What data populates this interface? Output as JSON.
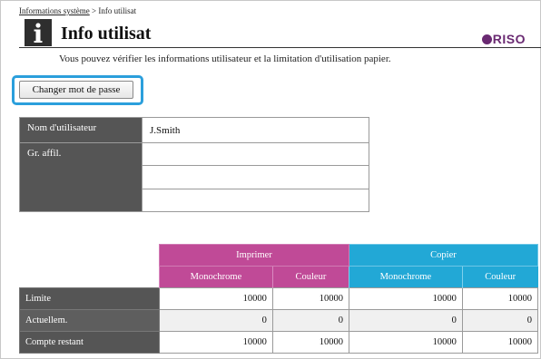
{
  "breadcrumb": {
    "parent": "Informations système",
    "separator": ">",
    "current": "Info utilisat"
  },
  "header": {
    "title": "Info utilisat",
    "subtitle": "Vous pouvez vérifier les informations utilisateur et la limitation d'utilisation papier.",
    "logo": "RISO"
  },
  "actions": {
    "change_password": "Changer mot de passe"
  },
  "user_info": {
    "name_label": "Nom d'utilisateur",
    "name_value": "J.Smith",
    "group_label": "Gr. affil.",
    "groups": [
      "",
      "",
      ""
    ]
  },
  "usage": {
    "print_label": "Imprimer",
    "copy_label": "Copier",
    "columns": [
      "Monochrome",
      "Couleur",
      "Monochrome",
      "Couleur"
    ],
    "rows": [
      {
        "label": "Limite",
        "values": [
          "10000",
          "10000",
          "10000",
          "10000"
        ]
      },
      {
        "label": "Actuellem.",
        "values": [
          "0",
          "0",
          "0",
          "0"
        ]
      },
      {
        "label": "Compte restant",
        "values": [
          "10000",
          "10000",
          "10000",
          "10000"
        ]
      }
    ]
  },
  "colors": {
    "print": "#c04a97",
    "copy": "#22a8d6",
    "header_cell": "#555555",
    "highlight": "#2b9fdc",
    "logo": "#6a2a72"
  }
}
